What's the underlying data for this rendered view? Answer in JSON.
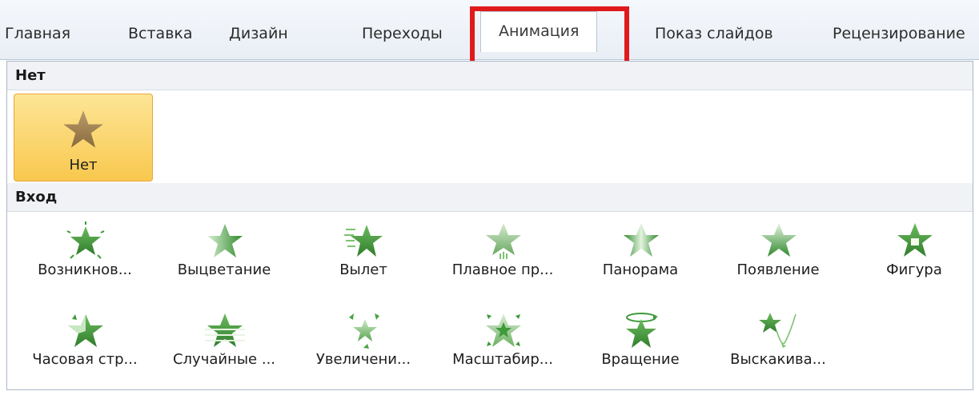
{
  "ribbon": {
    "tabs": [
      {
        "label": "Главная"
      },
      {
        "label": "Вставка"
      },
      {
        "label": "Дизайн"
      },
      {
        "label": "Переходы"
      },
      {
        "label": "Анимация"
      },
      {
        "label": "Показ слайдов"
      },
      {
        "label": "Рецензирование"
      }
    ],
    "active_tab": "Анимация",
    "highlight_color": "#e0191b"
  },
  "gallery": {
    "none_section": {
      "header": "Нет",
      "item": {
        "label": "Нет",
        "icon": "star-none-icon",
        "selected": true
      }
    },
    "entrance_section": {
      "header": "Вход",
      "items": [
        {
          "label": "Возникнов...",
          "icon": "appear-star-icon"
        },
        {
          "label": "Выцветание",
          "icon": "fade-star-icon"
        },
        {
          "label": "Вылет",
          "icon": "fly-in-star-icon"
        },
        {
          "label": "Плавное пр...",
          "icon": "float-in-star-icon"
        },
        {
          "label": "Панорама",
          "icon": "split-star-icon"
        },
        {
          "label": "Появление",
          "icon": "wipe-star-icon"
        },
        {
          "label": "Фигура",
          "icon": "shape-star-icon"
        },
        {
          "label": "Часовая стр...",
          "icon": "wheel-star-icon"
        },
        {
          "label": "Случайные ...",
          "icon": "random-bars-star-icon"
        },
        {
          "label": "Увеличени...",
          "icon": "grow-turn-star-icon"
        },
        {
          "label": "Масштабир...",
          "icon": "zoom-star-icon"
        },
        {
          "label": "Вращение",
          "icon": "swivel-star-icon"
        },
        {
          "label": "Выскакива...",
          "icon": "bounce-star-icon"
        }
      ]
    },
    "colors": {
      "star_green": "#3f9a3a",
      "star_none": "#9a7b4a",
      "selected_fill": "#f8c84e"
    }
  }
}
